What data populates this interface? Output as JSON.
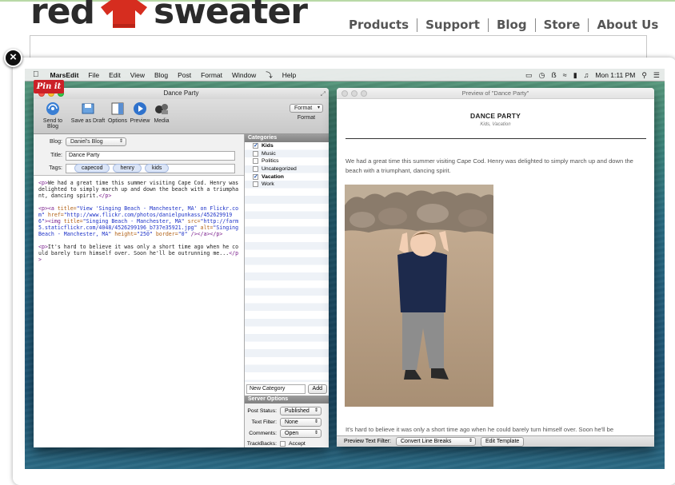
{
  "site": {
    "logo_left": "red",
    "logo_right": "sweater",
    "nav": [
      "Products",
      "Support",
      "Blog",
      "Store",
      "About Us"
    ],
    "brand_color": "#d62d1f"
  },
  "lightbox": {
    "close_glyph": "×"
  },
  "menubar": {
    "app": "MarsEdit",
    "items": [
      "File",
      "Edit",
      "View",
      "Blog",
      "Post",
      "Format",
      "Window",
      "Help"
    ],
    "clock": "Mon 1:11 PM"
  },
  "pinit": "Pin it",
  "marsedit": {
    "title": "Dance Party",
    "toolbar": {
      "send": "Send to Blog",
      "draft": "Save as Draft",
      "options": "Options",
      "preview": "Preview",
      "media": "Media",
      "format_value": "Format",
      "format_label": "Format"
    },
    "blog_label": "Blog:",
    "blog_value": "Daniel's Blog",
    "title_label": "Title:",
    "title_value": "Dance Party",
    "tags_label": "Tags:",
    "tags": [
      "capecod",
      "henry",
      "kids"
    ],
    "body": {
      "p1_open": "<p>",
      "p1_text": "We had a great time this summer visiting Cape Cod. Henry was delighted to simply march up and down the beach with a triumphant, dancing spirit.",
      "p1_close": "</p>",
      "p2_a": "<p><a ",
      "p2_title_attr": "title=",
      "p2_title_val": "\"View 'Singing Beach - Manchester, MA' on Flickr.com\"",
      "p2_href_attr": " href=",
      "p2_href_val": "\"http://www.flickr.com/photos/danielpunkass/4526299196\"",
      "p2_img": "><img ",
      "p2_img_title_attr": "title=",
      "p2_img_title_val": "\"Singing Beach - Manchester, MA\"",
      "p2_src_attr": " src=",
      "p2_src_val": "\"http://farm5.staticflickr.com/4048/4526299196_b737e35921.jpg\"",
      "p2_alt_attr": " alt=",
      "p2_alt_val": "\"Singing Beach - Manchester, MA\"",
      "p2_h_attr": " height=",
      "p2_h_val": "\"250\"",
      "p2_b_attr": " border=",
      "p2_b_val": "\"0\"",
      "p2_close": " /></a></p>",
      "p3_open": "<p>",
      "p3_text": "It's hard to believe it was only a short time ago when he could barely turn himself over. Soon he'll be outrunning me...",
      "p3_close": "</p>"
    },
    "categories_header": "Categories",
    "categories": [
      {
        "label": "Kids",
        "checked": true
      },
      {
        "label": "Music",
        "checked": false
      },
      {
        "label": "Politics",
        "checked": false
      },
      {
        "label": "Uncategorized",
        "checked": false
      },
      {
        "label": "Vacation",
        "checked": true
      },
      {
        "label": "Work",
        "checked": false
      }
    ],
    "new_category_placeholder": "New Category",
    "add_label": "Add",
    "server_header": "Server Options",
    "post_status_label": "Post Status:",
    "post_status_value": "Published",
    "text_filter_label": "Text Filter:",
    "text_filter_value": "None",
    "comments_label": "Comments:",
    "comments_value": "Open",
    "trackbacks_label": "TrackBacks:",
    "accept_label": "Accept"
  },
  "preview": {
    "window_title": "Preview of \"Dance Party\"",
    "heading": "DANCE PARTY",
    "subheading": "Kids, Vacation",
    "para1": "We had a great time this summer visiting Cape Cod. Henry was delighted to simply march up and down the beach with a triumphant, dancing spirit.",
    "para2": "It's hard to believe it was only a short time ago when he could barely turn himself over. Soon he'll be outrunning me...",
    "filter_label": "Preview Text Filter:",
    "filter_value": "Convert Line Breaks",
    "edit_template": "Edit Template"
  }
}
